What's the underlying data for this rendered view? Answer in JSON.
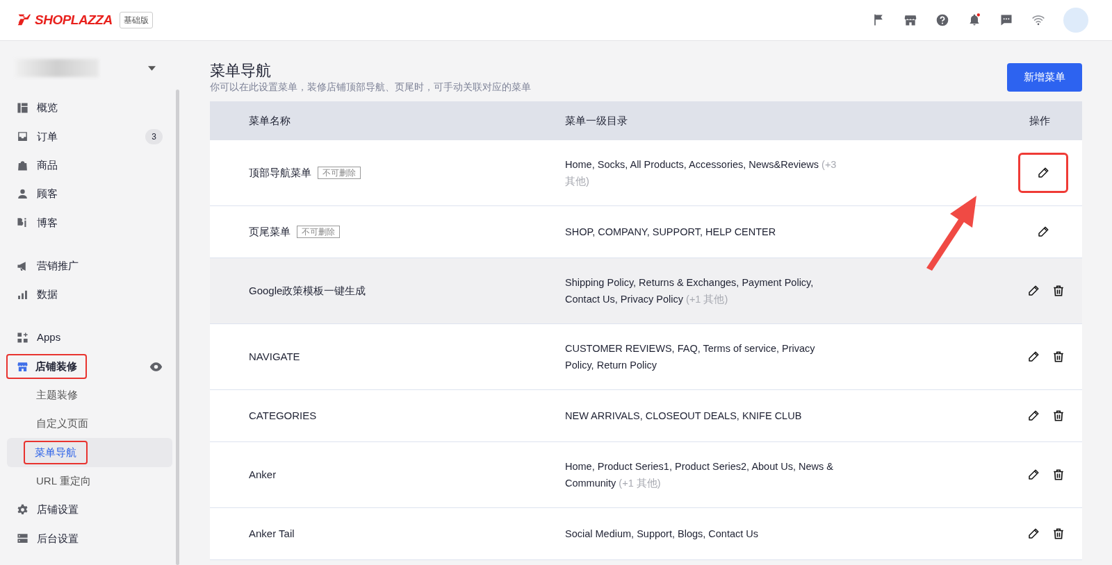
{
  "header": {
    "logo": "SHOPLAZZA",
    "plan": "基础版",
    "notifications_unread": true
  },
  "sidebar": {
    "groups": [
      [
        {
          "label": "概览",
          "selected": false,
          "highlighted": false,
          "preview": false
        },
        {
          "label": "订单",
          "badge": "3",
          "selected": false,
          "highlighted": false,
          "preview": false
        },
        {
          "label": "商品",
          "selected": false,
          "highlighted": false,
          "preview": false
        },
        {
          "label": "顾客",
          "selected": false,
          "highlighted": false,
          "preview": false
        },
        {
          "label": "博客",
          "selected": false,
          "highlighted": false,
          "preview": false
        }
      ],
      [
        {
          "label": "营销推广",
          "selected": false,
          "highlighted": false,
          "preview": false
        },
        {
          "label": "数据",
          "selected": false,
          "highlighted": false,
          "preview": false
        }
      ],
      [
        {
          "label": "Apps",
          "selected": false,
          "highlighted": false,
          "preview": false
        },
        {
          "label": "店铺装修",
          "selected": true,
          "highlighted": true,
          "preview": true,
          "children": [
            {
              "label": "主题装修",
              "selected": false,
              "highlighted": false
            },
            {
              "label": "自定义页面",
              "selected": false,
              "highlighted": false
            },
            {
              "label": "菜单导航",
              "selected": true,
              "highlighted": true
            },
            {
              "label": "URL 重定向",
              "selected": false,
              "highlighted": false
            }
          ]
        },
        {
          "label": "店铺设置",
          "selected": false,
          "highlighted": false,
          "preview": false
        },
        {
          "label": "后台设置",
          "selected": false,
          "highlighted": false,
          "preview": false
        }
      ]
    ]
  },
  "page": {
    "title": "菜单导航",
    "subtitle": "你可以在此设置菜单，装修店铺顶部导航、页尾时，可手动关联对应的菜单",
    "add_button": "新增菜单"
  },
  "table": {
    "columns": [
      "菜单名称",
      "菜单一级目录",
      "操作"
    ],
    "rows": [
      {
        "name": "顶部导航菜单",
        "tag": "不可删除",
        "items": "Home, Socks, All Products, Accessories, News&Reviews",
        "more": "(+3 其他)",
        "deletable": false,
        "hovered": false,
        "highlighted": true
      },
      {
        "name": "页尾菜单",
        "tag": "不可删除",
        "items": "SHOP, COMPANY, SUPPORT, HELP CENTER",
        "deletable": false,
        "hovered": false,
        "highlighted": false
      },
      {
        "name": "Google政策模板一键生成",
        "items": "Shipping Policy, Returns & Exchanges, Payment Policy, Contact Us, Privacy Policy",
        "more": "(+1 其他)",
        "deletable": true,
        "hovered": true,
        "highlighted": false
      },
      {
        "name": "NAVIGATE",
        "items": "CUSTOMER REVIEWS, FAQ, Terms of service, Privacy Policy, Return Policy",
        "deletable": true,
        "hovered": false,
        "highlighted": false
      },
      {
        "name": "CATEGORIES",
        "items": "NEW ARRIVALS, CLOSEOUT DEALS, KNIFE CLUB",
        "deletable": true,
        "hovered": false,
        "highlighted": false
      },
      {
        "name": "Anker",
        "items": "Home, Product Series1, Product Series2, About Us, News & Community",
        "more": "(+1 其他)",
        "deletable": true,
        "hovered": false,
        "highlighted": false
      },
      {
        "name": "Anker Tail",
        "items": "Social Medium, Support, Blogs, Contact Us",
        "deletable": true,
        "hovered": false,
        "highlighted": false
      }
    ]
  }
}
